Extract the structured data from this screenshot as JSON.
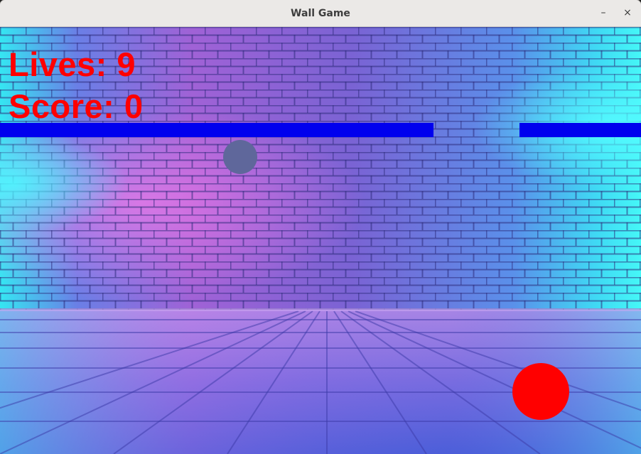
{
  "window": {
    "title": "Wall Game",
    "minimize_glyph": "–",
    "close_glyph": "×"
  },
  "hud": {
    "lives_label": "Lives: 9",
    "score_label": "Score: 0"
  },
  "game": {
    "background": "neon-brick-wall",
    "colors": {
      "bar": "#0000ee",
      "hud_text": "#ff0000",
      "player_ball": "#ff0000",
      "enemy_ball": "#5f679b"
    }
  }
}
